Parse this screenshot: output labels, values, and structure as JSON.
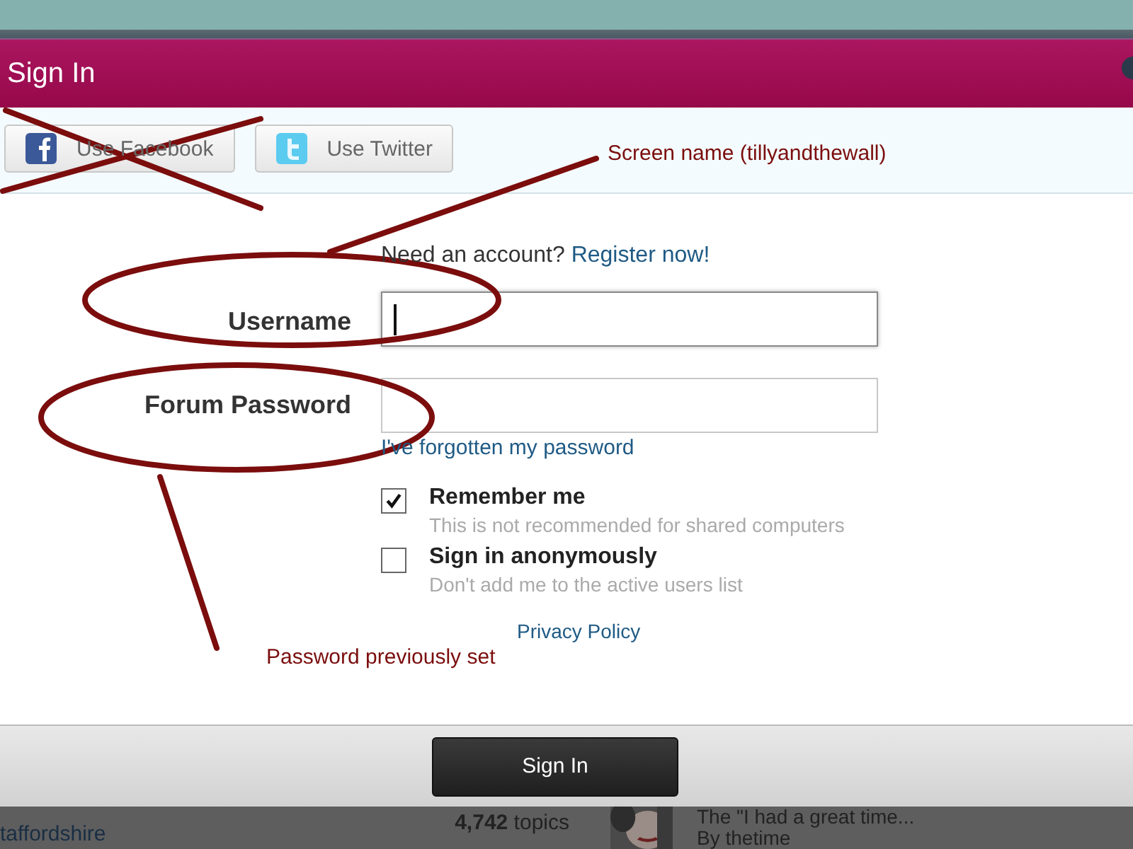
{
  "dialog": {
    "title": "Sign In"
  },
  "social_buttons": [
    {
      "label": "Use Facebook",
      "kind": "facebook"
    },
    {
      "label": "Use Twitter",
      "kind": "twitter"
    }
  ],
  "register": {
    "prompt": "Need an account?",
    "link": "Register now!"
  },
  "fields": [
    {
      "label": "Username",
      "focused": true
    },
    {
      "label": "Forum Password",
      "focused": false
    }
  ],
  "forgot_link": "I've forgotten my password",
  "options": [
    {
      "label": "Remember me",
      "hint": "This is not recommended for shared computers",
      "checked": true
    },
    {
      "label": "Sign in anonymously",
      "hint": "Don't add me to the active users list",
      "checked": false
    }
  ],
  "privacy_link": "Privacy Policy",
  "submit_button": "Sign In",
  "annotations": [
    {
      "text": "Screen name (tillyandthewall)"
    },
    {
      "text": "Password previously set"
    }
  ],
  "background_page": {
    "forum_name": "taffordshire",
    "topics_count": "4,742",
    "topics_label": "topics",
    "last_post_title": "The \"I had a great time...",
    "last_post_by": "By thetime"
  }
}
